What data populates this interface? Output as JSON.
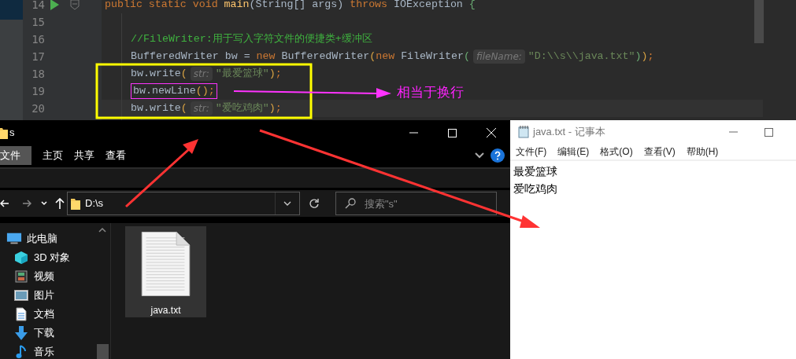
{
  "editor": {
    "lines": [
      {
        "number": "14",
        "run_marker": true,
        "current": false,
        "framed": false,
        "segments": [
          {
            "kind": "keyword",
            "text": "public static void "
          },
          {
            "kind": "method",
            "text": "main"
          },
          {
            "kind": "plain",
            "text": "(String[] args) "
          },
          {
            "kind": "keyword",
            "text": "throws "
          },
          {
            "kind": "plain",
            "text": "IOException "
          },
          {
            "kind": "brace",
            "text": "{"
          }
        ]
      },
      {
        "number": "15",
        "run_marker": false,
        "current": false,
        "framed": false
      },
      {
        "number": "16",
        "run_marker": false,
        "current": false,
        "framed": false,
        "segments": [
          {
            "kind": "comment",
            "text": "//FileWriter:用于写入字符文件的便捷类+缓冲区"
          }
        ]
      },
      {
        "number": "17",
        "run_marker": false,
        "current": false,
        "framed": false,
        "segments": [
          {
            "kind": "plain",
            "text": "BufferedWriter bw = "
          },
          {
            "kind": "keyword",
            "text": "new "
          },
          {
            "kind": "plain",
            "text": "BufferedWriter"
          },
          {
            "kind": "paren",
            "text": "("
          },
          {
            "kind": "keyword",
            "text": "new "
          },
          {
            "kind": "plain",
            "text": "FileWriter"
          },
          {
            "kind": "brace",
            "text": "("
          },
          {
            "kind": "hint",
            "text": "fileName:"
          },
          {
            "kind": "string",
            "text": "\"D:\\\\s\\\\java.txt\""
          },
          {
            "kind": "brace",
            "text": ")"
          },
          {
            "kind": "paren",
            "text": ")"
          },
          {
            "kind": "keyword",
            "text": ";"
          }
        ]
      },
      {
        "number": "18",
        "run_marker": false,
        "current": false,
        "framed": false,
        "segments": [
          {
            "kind": "plain",
            "text": "bw.write"
          },
          {
            "kind": "paren",
            "text": "("
          },
          {
            "kind": "hint",
            "text": "str:"
          },
          {
            "kind": "string",
            "text": "\"最爱篮球\""
          },
          {
            "kind": "paren",
            "text": ")"
          },
          {
            "kind": "keyword",
            "text": ";"
          }
        ]
      },
      {
        "number": "19",
        "run_marker": false,
        "current": false,
        "framed": true,
        "segments": [
          {
            "kind": "plain",
            "text": "bw.newLine"
          },
          {
            "kind": "paren",
            "text": "()"
          },
          {
            "kind": "keyword",
            "text": ";"
          }
        ]
      },
      {
        "number": "20",
        "run_marker": false,
        "current": true,
        "framed": false,
        "segments": [
          {
            "kind": "plain",
            "text": "bw.write"
          },
          {
            "kind": "paren",
            "text": "("
          },
          {
            "kind": "hint",
            "text": "str:"
          },
          {
            "kind": "string",
            "text": "\"爱吃鸡肉\""
          },
          {
            "kind": "paren",
            "text": ")"
          },
          {
            "kind": "keyword",
            "text": ";"
          }
        ]
      }
    ],
    "note": "相当于换行"
  },
  "explorer": {
    "title": "s",
    "ribbon_tabs": [
      {
        "label": "文件",
        "selected": true
      },
      {
        "label": "主页",
        "selected": false
      },
      {
        "label": "共享",
        "selected": false
      },
      {
        "label": "查看",
        "selected": false
      }
    ],
    "address": "D:\\s",
    "search": {
      "placeholder": "搜索\"s\""
    },
    "sidebar": [
      {
        "label": "此电脑",
        "kind": "pc",
        "children": [
          {
            "label": "3D 对象",
            "kind": "cube"
          },
          {
            "label": "视频",
            "kind": "video"
          },
          {
            "label": "图片",
            "kind": "picture"
          },
          {
            "label": "文档",
            "kind": "document"
          },
          {
            "label": "下载",
            "kind": "download"
          },
          {
            "label": "音乐",
            "kind": "music"
          }
        ]
      }
    ],
    "files": [
      {
        "name": "java.txt",
        "selected": true
      }
    ]
  },
  "notepad": {
    "title": "java.txt - 记事本",
    "menu": [
      "文件(F)",
      "编辑(E)",
      "格式(O)",
      "查看(V)",
      "帮助(H)"
    ],
    "lines": [
      "最爱篮球",
      "爱吃鸡肉"
    ]
  }
}
